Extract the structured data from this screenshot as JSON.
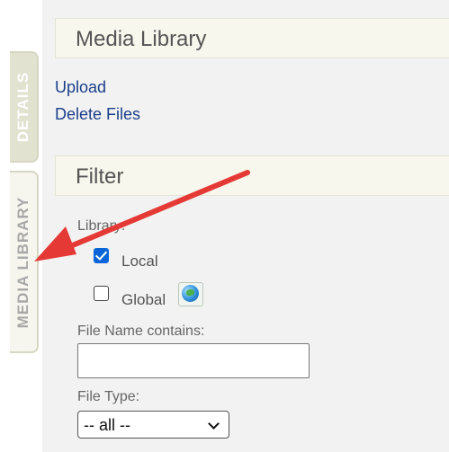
{
  "tabs": {
    "details": "DETAILS",
    "media_library": "MEDIA LIBRARY"
  },
  "media_library": {
    "title": "Media Library",
    "links": {
      "upload": "Upload",
      "delete_files": "Delete Files"
    }
  },
  "filter": {
    "title": "Filter",
    "library_label": "Library:",
    "local_label": "Local",
    "local_checked": true,
    "global_label": "Global",
    "global_checked": false,
    "file_name_label": "File Name contains:",
    "file_name_value": "",
    "file_type_label": "File Type:",
    "file_type_selected": "-- all --"
  },
  "annotation": {
    "arrow_color": "#e53935"
  }
}
